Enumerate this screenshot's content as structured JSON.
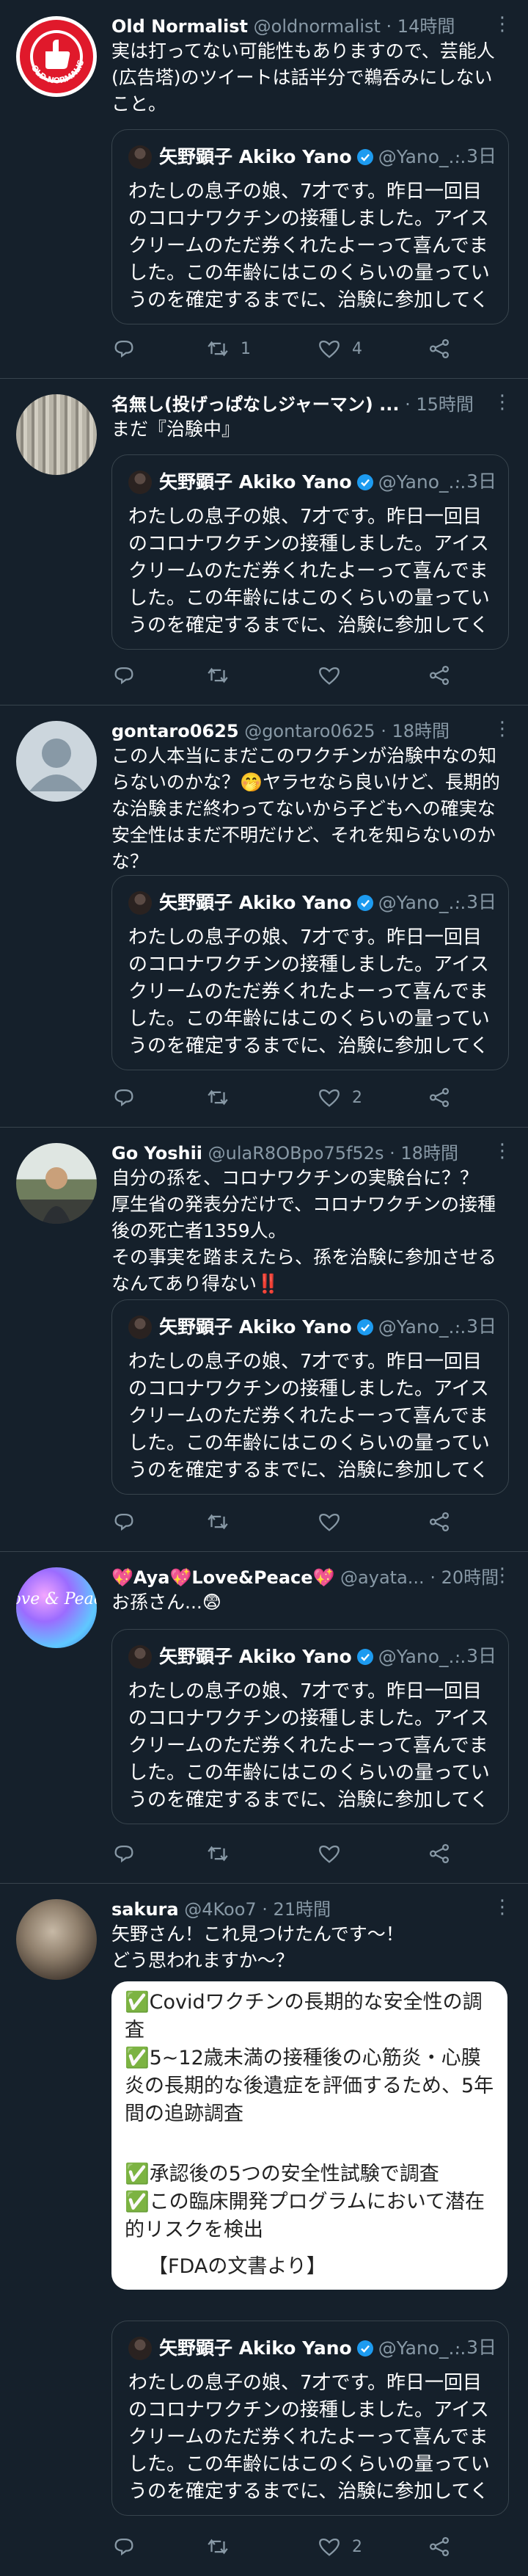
{
  "quoted": {
    "name": "矢野顕子 Akiko Yano",
    "handle": "@Yano_...",
    "time": "· 3日",
    "text": "わたしの息子の娘、7才です。昨日一回目のコロナワクチンの接種しました。アイスクリームのただ券くれたよーって喜んでました。この年齢にはこのくらいの量っていうのを確定するまでに、治験に参加してくれ..."
  },
  "tweets": [
    {
      "name": "Old Normalist",
      "handle": "@oldnormalist",
      "time": "· 14時間",
      "text": "実は打ってない可能性もありますので、芸能人(広告塔)のツイートは話半分で鵜呑みにしないこと。",
      "reply_count": "",
      "retweet_count": "1",
      "like_count": "4"
    },
    {
      "name": "名無し(投げっぱなしジャーマン) ...",
      "handle": "",
      "time": "· 15時間",
      "text": "まだ『治験中』",
      "reply_count": "",
      "retweet_count": "",
      "like_count": ""
    },
    {
      "name": "gontaro0625",
      "handle": "@gontaro0625",
      "time": "· 18時間",
      "text": "この人本当にまだこのワクチンが治験中なの知らないのかな？🤭ヤラセなら良いけど、長期的な治験まだ終わってないから子どもへの確実な安全性はまだ不明だけど、それを知らないのかな？",
      "reply_count": "",
      "retweet_count": "",
      "like_count": "2"
    },
    {
      "name": "Go Yoshii",
      "handle": "@ulaR8OBpo75f52s",
      "time": "· 18時間",
      "text": "自分の孫を、コロナワクチンの実験台に？？\n厚生省の発表分だけで、コロナワクチンの接種後の死亡者1359人。\nその事実を踏まえたら、孫を治験に参加させるなんてあり得ない‼️",
      "reply_count": "",
      "retweet_count": "",
      "like_count": ""
    },
    {
      "name": "💖Aya💖Love&Peace💖",
      "handle": "@ayata...",
      "time": "· 20時間",
      "text": "お孫さん...😨",
      "reply_count": "",
      "retweet_count": "",
      "like_count": ""
    },
    {
      "name": "sakura",
      "handle": "@4Koo7",
      "time": "· 21時間",
      "text": "矢野さん！これ見つけたんです〜！\nどう思われますか〜？",
      "reply_count": "",
      "retweet_count": "",
      "like_count": "2"
    }
  ],
  "fda_note": {
    "line1": "✅Covidワクチンの長期的な安全性の調査",
    "line2": "✅5~12歳未満の接種後の心筋炎・心膜炎の長期的な後遺症を評価するため、5年間の追跡調査",
    "line3": "✅承認後の5つの安全性試験で調査",
    "line4": "✅この臨床開発プログラムにおいて潜在的リスクを検出",
    "source": "【FDAの文書より】"
  },
  "avatar_badge_text": "OLD NORMALIST",
  "avatar_love_text": "Love & Peace",
  "colors": {
    "background": "#15202b",
    "border": "#38444d",
    "secondary": "#8899a6",
    "verified": "#1d9bf0"
  }
}
